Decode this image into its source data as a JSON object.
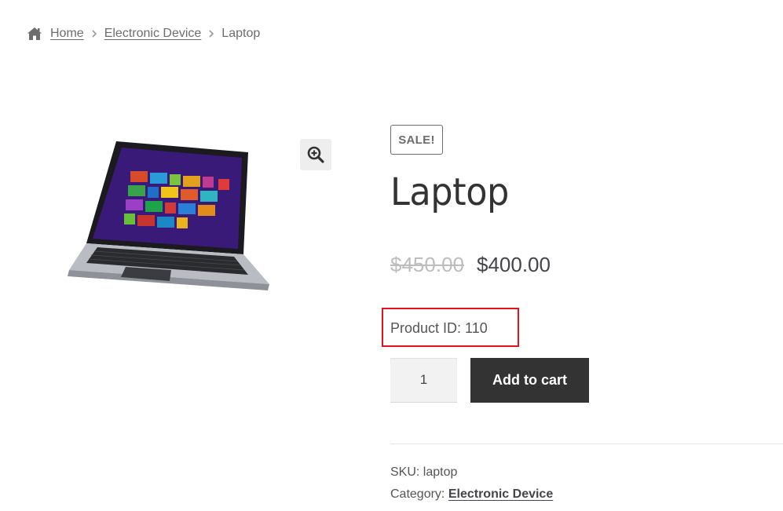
{
  "breadcrumb": {
    "home": "Home",
    "category": "Electronic Device",
    "current": "Laptop"
  },
  "gallery": {
    "image_alt": "Laptop",
    "zoom_icon": "zoom-in-icon"
  },
  "product": {
    "badge": "SALE!",
    "title": "Laptop",
    "old_price": "$450.00",
    "new_price": "$400.00",
    "product_id": "Product ID: 110",
    "quantity": "1",
    "add_to_cart": "Add to cart"
  },
  "meta": {
    "sku_label": "SKU:",
    "sku_value": "laptop",
    "category_label": "Category:",
    "category_value": "Electronic Device"
  },
  "colors": {
    "highlight": "#e8101c",
    "button": "#333333"
  }
}
